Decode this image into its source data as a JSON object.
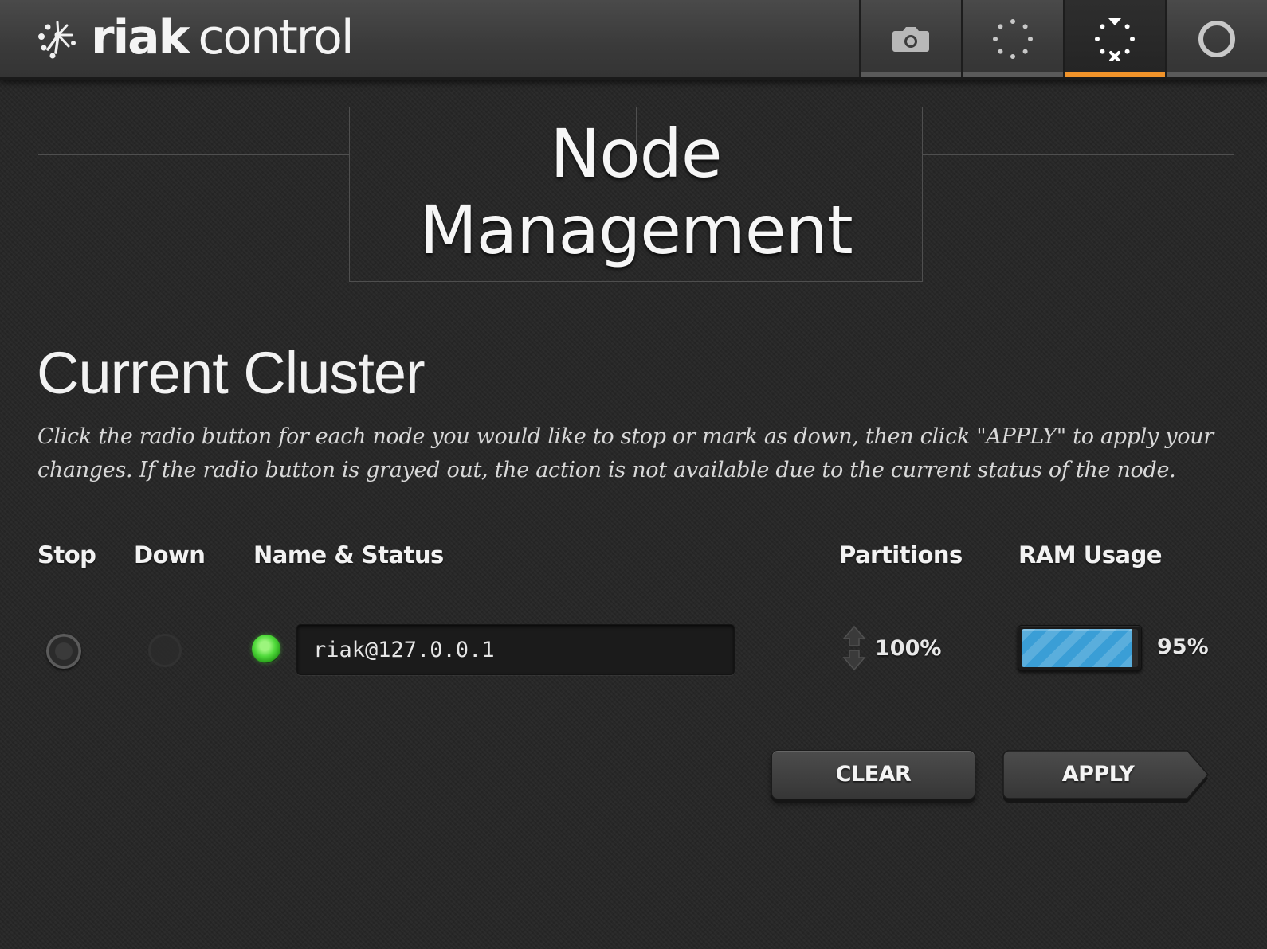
{
  "app": {
    "brand": "riak",
    "product": "control"
  },
  "nav": {
    "items": [
      {
        "name": "snapshot",
        "icon": "camera-icon",
        "active": false
      },
      {
        "name": "cluster",
        "icon": "ring-dotted-icon",
        "active": false
      },
      {
        "name": "nodes",
        "icon": "node-management-icon",
        "active": true
      },
      {
        "name": "ring",
        "icon": "ring-circle-icon",
        "active": false
      }
    ]
  },
  "page": {
    "title_line1": "Node",
    "title_line2": "Management"
  },
  "section": {
    "heading": "Current Cluster",
    "instructions": "Click the radio button for each node you would like to stop or mark as down, then click \"APPLY\" to apply your changes. If the radio button is grayed out, the action is not available due to the current status of the node."
  },
  "table": {
    "headers": {
      "stop": "Stop",
      "down": "Down",
      "name_status": "Name & Status",
      "partitions": "Partitions",
      "ram_usage": "RAM Usage"
    },
    "rows": [
      {
        "name": "riak@127.0.0.1",
        "status": "valid",
        "status_color": "#4fd93a",
        "stop_enabled": true,
        "down_enabled": false,
        "partitions": "100%",
        "ram_usage": "95%",
        "ram_fraction": 0.95
      }
    ]
  },
  "actions": {
    "clear_label": "CLEAR",
    "apply_label": "APPLY"
  },
  "colors": {
    "accent": "#f0932a",
    "ram_bar": "#3a9ed6",
    "background": "#262626"
  }
}
